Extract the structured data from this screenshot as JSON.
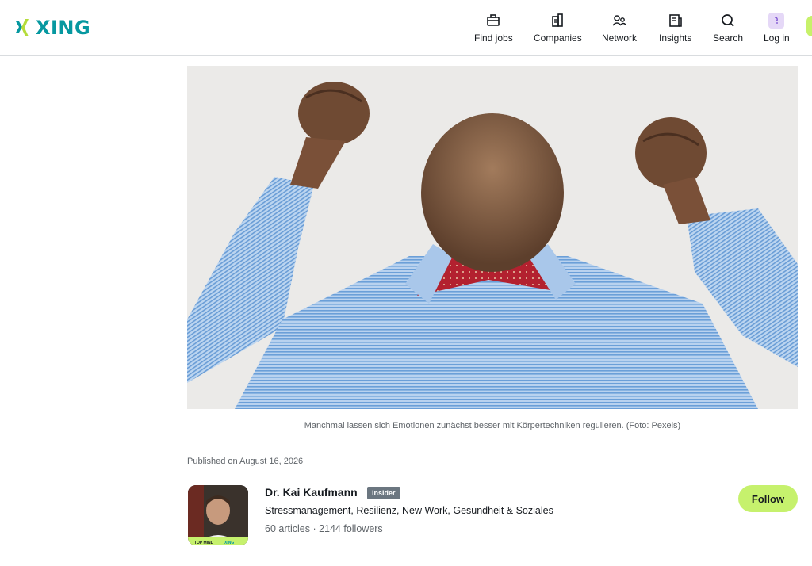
{
  "brand": {
    "name": "XING",
    "color": "#0698a0",
    "accent": "#c6f16d"
  },
  "nav": {
    "find_jobs": "Find jobs",
    "companies": "Companies",
    "network": "Network",
    "insights": "Insights",
    "search": "Search",
    "log_in": "Log in"
  },
  "article": {
    "image_caption": "Manchmal lassen sich Emotionen zunächst besser mit Körpertechniken regulieren. (Foto: Pexels)",
    "published": "Published on August 16, 2026"
  },
  "author": {
    "name": "Dr. Kai Kaufmann",
    "badge": "Insider",
    "tags": "Stressmanagement, Resilienz, New Work, Gesundheit & Soziales",
    "stats": "60 articles · 2144 followers",
    "photo_banner_left": "TOP MIND",
    "photo_banner_right": "XING",
    "follow_label": "Follow"
  }
}
